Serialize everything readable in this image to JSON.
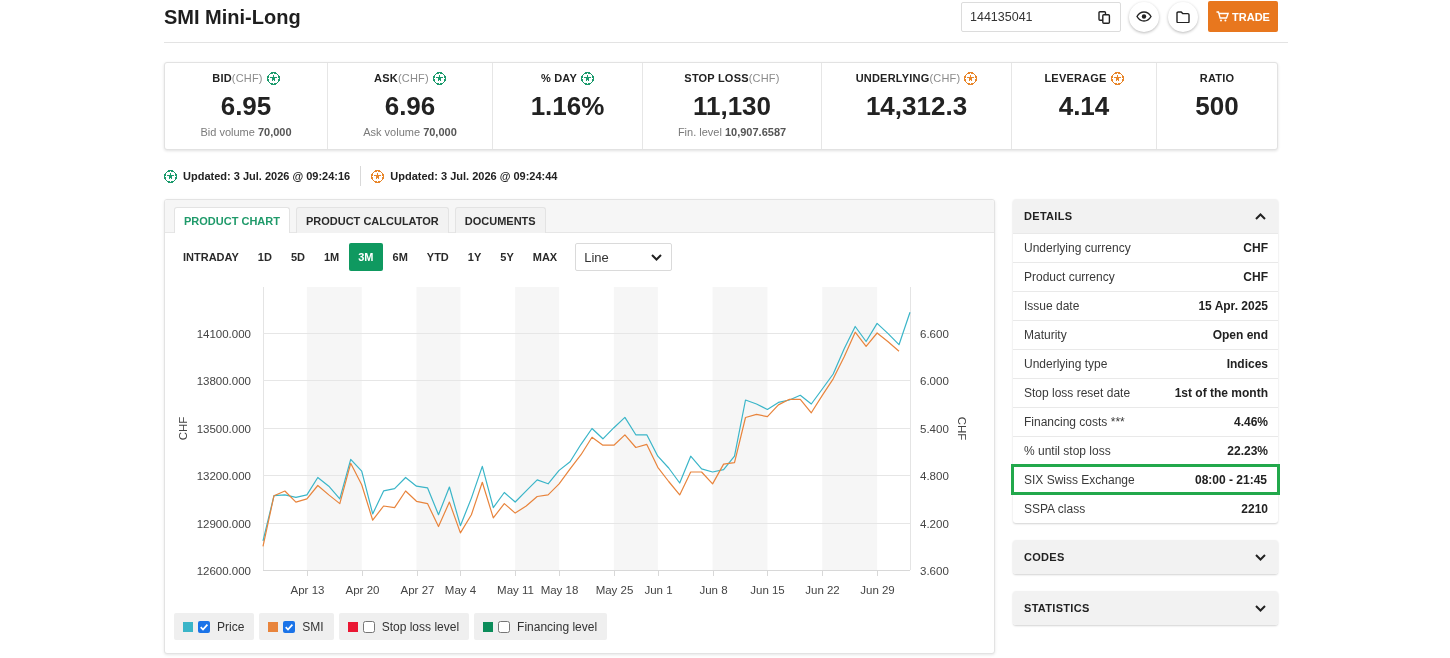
{
  "header": {
    "title": "SMI Mini-Long",
    "code_field": {
      "value": "144135041"
    },
    "trade_button": {
      "label": "TRADE"
    }
  },
  "stats": [
    {
      "label": "BID",
      "unit": "(CHF)",
      "color": "#1a9a6c",
      "value": "6.95",
      "note": "Bid volume **70,000**"
    },
    {
      "label": "ASK",
      "unit": "(CHF)",
      "color": "#1a9a6c",
      "value": "6.96",
      "note": "Ask volume **70,000**"
    },
    {
      "label": "% DAY",
      "color": "#1a9a6c",
      "value": "1.16%"
    },
    {
      "label": "STOP LOSS",
      "unit": "(CHF)",
      "value": "11,130",
      "note": "Fin. level **10,907.6587**"
    },
    {
      "label": "UNDERLYING",
      "unit": "(CHF)",
      "color": "#e8862a",
      "value": "14,312.3"
    },
    {
      "label": "LEVERAGE",
      "color": "#e8862a",
      "value": "4.14"
    },
    {
      "label": "RATIO",
      "value": "500"
    }
  ],
  "updates": [
    {
      "color": "#1a9a6c",
      "text": "Updated: 3 Jul. 2026 @ 09:24:16"
    },
    {
      "color": "#e8862a",
      "text": "Updated: 3 Jul. 2026 @ 09:24:44"
    }
  ],
  "chart_panel": {
    "tabs": [
      {
        "label": "PRODUCT CHART",
        "selected": true
      },
      {
        "label": "PRODUCT CALCULATOR",
        "selected": false
      },
      {
        "label": "DOCUMENTS",
        "selected": false
      }
    ],
    "periods": [
      {
        "label": "INTRADAY",
        "selected": false
      },
      {
        "label": "1D",
        "selected": false
      },
      {
        "label": "5D",
        "selected": false
      },
      {
        "label": "1M",
        "selected": false
      },
      {
        "label": "3M",
        "selected": true
      },
      {
        "label": "6M",
        "selected": false
      },
      {
        "label": "YTD",
        "selected": false
      },
      {
        "label": "1Y",
        "selected": false
      },
      {
        "label": "5Y",
        "selected": false
      },
      {
        "label": "MAX",
        "selected": false
      }
    ],
    "chart_type_select": {
      "value": "Line"
    },
    "chart_data": {
      "type": "line",
      "grid": true,
      "ylabel": "CHF",
      "y2label": "CHF",
      "categories": [
        null,
        null,
        null,
        null,
        "Apr 13",
        null,
        null,
        null,
        null,
        "Apr 20",
        null,
        null,
        null,
        null,
        "Apr 27",
        null,
        null,
        null,
        "May 4",
        null,
        null,
        null,
        null,
        "May 11",
        null,
        null,
        null,
        "May 18",
        null,
        null,
        null,
        null,
        "May 25",
        null,
        null,
        null,
        "Jun 1",
        null,
        null,
        null,
        null,
        "Jun 8",
        null,
        null,
        null,
        null,
        "Jun 15",
        null,
        null,
        null,
        null,
        "Jun 22",
        null,
        null,
        null,
        null,
        "Jun 29",
        null,
        null,
        null
      ],
      "ylim": [
        12600,
        14391
      ],
      "yticks": [
        {
          "value": 12600,
          "label": "12600.000"
        },
        {
          "value": 12900,
          "label": "12900.000"
        },
        {
          "value": 13200,
          "label": "13200.000"
        },
        {
          "value": 13500,
          "label": "13500.000"
        },
        {
          "value": 13800,
          "label": "13800.000"
        },
        {
          "value": 14100,
          "label": "14100.000"
        }
      ],
      "y2lim": [
        3.6,
        7.18
      ],
      "y2ticks": [
        {
          "value": 3.6,
          "label": "3.600"
        },
        {
          "value": 4.2,
          "label": "4.200"
        },
        {
          "value": 4.8,
          "label": "4.800"
        },
        {
          "value": 5.4,
          "label": "5.400"
        },
        {
          "value": 6.0,
          "label": "6.000"
        },
        {
          "value": 6.6,
          "label": "6.600"
        }
      ],
      "series": [
        {
          "color": "#3ab5c8",
          "axis": "y2",
          "values": [
            3.97,
            4.54,
            4.55,
            4.52,
            4.55,
            4.77,
            4.66,
            4.5,
            5.0,
            4.85,
            4.31,
            4.6,
            4.63,
            4.77,
            4.66,
            4.64,
            4.3,
            4.65,
            4.16,
            4.51,
            4.91,
            4.39,
            4.58,
            4.46,
            4.6,
            4.74,
            4.69,
            4.86,
            4.97,
            5.19,
            5.39,
            5.26,
            5.4,
            5.53,
            5.31,
            5.31,
            5.04,
            4.89,
            4.7,
            5.04,
            4.88,
            4.84,
            4.87,
            5.04,
            5.75,
            5.7,
            5.63,
            5.72,
            5.75,
            5.81,
            5.7,
            5.89,
            6.08,
            6.4,
            6.68,
            6.49,
            6.72,
            6.59,
            6.45,
            6.86
          ]
        },
        {
          "color": "#e8843c",
          "values": [
            12750,
            13070,
            13100,
            13030,
            13050,
            13135,
            13075,
            13020,
            13275,
            13140,
            12915,
            13005,
            12995,
            13100,
            13035,
            13020,
            12875,
            13030,
            12835,
            12950,
            13155,
            12930,
            13020,
            12960,
            13005,
            13065,
            13075,
            13145,
            13240,
            13330,
            13440,
            13390,
            13390,
            13455,
            13375,
            13395,
            13250,
            13160,
            13075,
            13220,
            13220,
            13145,
            13270,
            13280,
            13565,
            13585,
            13570,
            13645,
            13680,
            13680,
            13595,
            13705,
            13810,
            13950,
            14105,
            14015,
            14100,
            14045,
            13985,
            null
          ]
        }
      ]
    },
    "legend": [
      {
        "label": "Price",
        "color": "#3ab5c8",
        "checked": true
      },
      {
        "label": "SMI",
        "color": "#e8843c",
        "checked": true
      },
      {
        "label": "Stop loss level",
        "color": "#ea1733",
        "checked": false
      },
      {
        "label": "Financing level",
        "color": "#0b8c5a",
        "checked": false
      }
    ]
  },
  "accordions": [
    {
      "title": "DETAILS",
      "expanded": true,
      "rows": [
        {
          "label": "Underlying currency",
          "value": "CHF",
          "highlighted": false
        },
        {
          "label": "Product currency",
          "value": "CHF",
          "highlighted": false
        },
        {
          "label": "Issue date",
          "value": "15 Apr. 2025",
          "highlighted": false
        },
        {
          "label": "Maturity",
          "value": "Open end",
          "highlighted": false
        },
        {
          "label": "Underlying type",
          "value": "Indices",
          "highlighted": false
        },
        {
          "label": "Stop loss reset date",
          "value": "1st of the month",
          "highlighted": false
        },
        {
          "label": "Financing costs ***",
          "value": "4.46%",
          "highlighted": false
        },
        {
          "label": "% until stop loss",
          "value": "22.23%",
          "highlighted": false
        },
        {
          "label": "SIX Swiss Exchange",
          "value": "08:00 - 21:45",
          "highlighted": true
        },
        {
          "label": "SSPA class",
          "value": "2210",
          "highlighted": false
        }
      ]
    },
    {
      "title": "CODES",
      "expanded": false
    },
    {
      "title": "STATISTICS",
      "expanded": false
    }
  ]
}
